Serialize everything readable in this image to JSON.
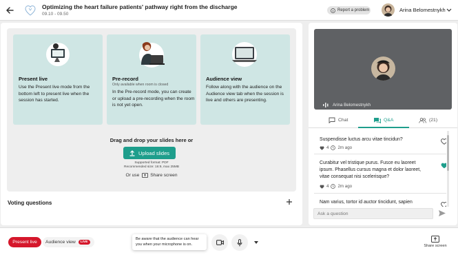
{
  "header": {
    "event_title": "Optimizing the heart failure patients' pathway right from the discharge",
    "event_time": "09.10 - 09.50",
    "report_label": "Report a problem",
    "user_name": "Arina Belomestnykh"
  },
  "modes": [
    {
      "title": "Present live",
      "subtitle": "",
      "description": "Use the Present live mode from the bottom left to present live when the session has started."
    },
    {
      "title": "Pre-record",
      "subtitle": "Only available when room is closed",
      "description": "In the Pre-record mode, you can create or upload a pre-recording when the room is not yet open."
    },
    {
      "title": "Audience view",
      "subtitle": "",
      "description": "Follow along with the audience on the Audience view tab when the session is live and others are presenting."
    }
  ],
  "upload": {
    "drag_text": "Drag and drop your slides here or",
    "button_label": "Upload slides",
    "supported_format": "Supported format: PDF",
    "recommended_size": "Recommended size: 16:9, max 25MB",
    "or_use": "Or use",
    "share_screen_label": "Share screen"
  },
  "voting": {
    "title": "Voting questions"
  },
  "video": {
    "speaker_name": "Arina Belomestnykh"
  },
  "tabs": {
    "chat": "Chat",
    "qa": "Q&A",
    "people_count": "(21)",
    "active": "Q&A"
  },
  "questions": [
    {
      "text": "Suspendisse luctus arcu vitae tincidun?",
      "likes": "4",
      "time": "2m ago",
      "liked": false
    },
    {
      "text": "Curabitur vel tristique purus. Fusce eu laoreet ipsum. Phasellus cursus magna et dolor laoreet, vitae consequat nisi scelerisque?",
      "likes": "4",
      "time": "2m ago",
      "liked": true
    },
    {
      "text": "Nam varius, tortor id auctor tincidunt, sapien",
      "likes": "",
      "time": "",
      "liked": false
    }
  ],
  "ask": {
    "placeholder": "Ask a question"
  },
  "bottom": {
    "present_live": "Present live",
    "audience_view": "Audience view",
    "live_badge": "LIVE",
    "mic_tip": "Be aware that the audience can hear you when your microphone is on.",
    "share_screen": "Share screen"
  },
  "colors": {
    "accent": "#1e9e8c",
    "card_bg": "#cfe6e4",
    "live_red": "#d5172b",
    "video_bg": "#5f6164"
  }
}
